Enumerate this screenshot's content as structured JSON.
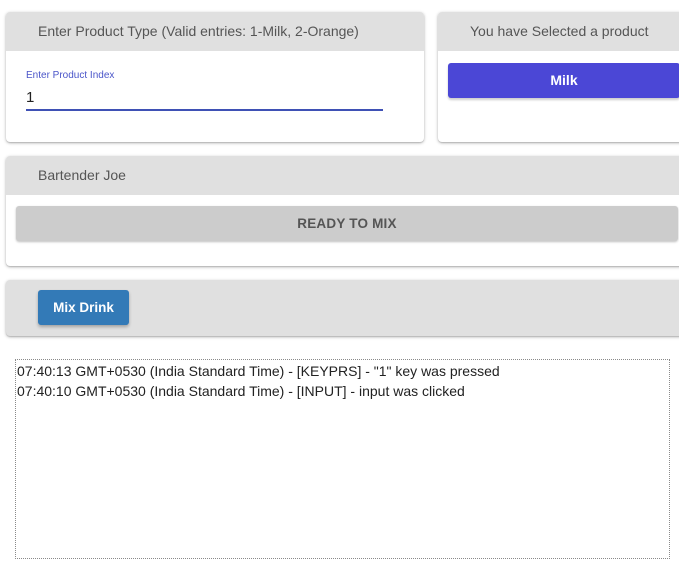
{
  "product_card": {
    "header": "Enter Product Type (Valid entries: 1-Milk, 2-Orange)",
    "field_label": "Enter Product Index",
    "field_value": "1"
  },
  "selected_card": {
    "header": "You have Selected a product",
    "button_label": "Milk"
  },
  "bartender_card": {
    "header": "Bartender Joe",
    "status": "READY TO MIX"
  },
  "actions": {
    "mix_button_label": "Mix Drink"
  },
  "log": [
    "07:40:13 GMT+0530 (India Standard Time) - [KEYPRS] - \"1\" key was pressed",
    "07:40:10 GMT+0530 (India Standard Time) - [INPUT] - input was clicked"
  ],
  "colors": {
    "header_bg": "#e0e0e0",
    "selected_button": "#4b47d6",
    "mix_button": "#337ab7",
    "status_bar": "#cccccc",
    "input_underline": "#3f51b5"
  }
}
